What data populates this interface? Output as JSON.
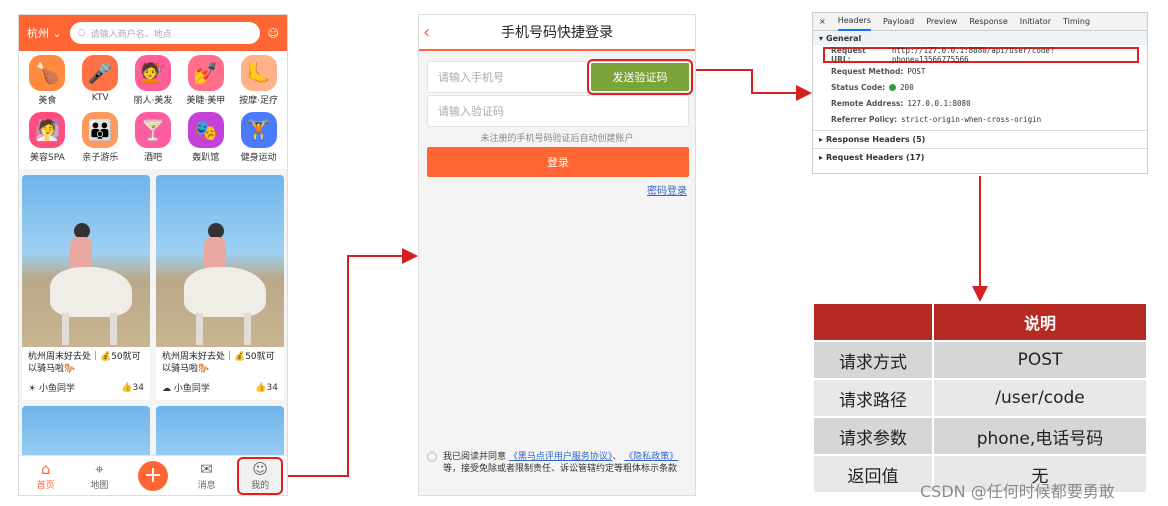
{
  "phone1": {
    "city": "杭州",
    "search_placeholder": "请输入商户名、地点",
    "categories": [
      {
        "label": "美食",
        "icon": "chicken-icon",
        "color": "#ff8a3d",
        "glyph": "🍗"
      },
      {
        "label": "KTV",
        "icon": "microphone-icon",
        "color": "#ff7043",
        "glyph": "🎤"
      },
      {
        "label": "丽人·美发",
        "icon": "hair-icon",
        "color": "#ff5e9a",
        "glyph": "💇"
      },
      {
        "label": "美睫·美甲",
        "icon": "nail-icon",
        "color": "#ff6f8a",
        "glyph": "💅"
      },
      {
        "label": "按摩·足疗",
        "icon": "foot-icon",
        "color": "#ffb28a",
        "glyph": "🦶"
      },
      {
        "label": "美容SPA",
        "icon": "mask-icon",
        "color": "#ff4d7d",
        "glyph": "🧖"
      },
      {
        "label": "亲子游乐",
        "icon": "family-icon",
        "color": "#ff9a5c",
        "glyph": "👪"
      },
      {
        "label": "酒吧",
        "icon": "cocktail-icon",
        "color": "#ff5da2",
        "glyph": "🍸"
      },
      {
        "label": "轰趴馆",
        "icon": "party-mask-icon",
        "color": "#c542d8",
        "glyph": "🎭"
      },
      {
        "label": "健身运动",
        "icon": "dumbbell-icon",
        "color": "#4a7bff",
        "glyph": "🏋"
      }
    ],
    "cards": [
      {
        "title": "杭州周末好去处｜💰50就可以骑马啦🐎",
        "author": "小鱼同学",
        "likes": "34"
      },
      {
        "title": "杭州周末好去处｜💰50就可以骑马啦🐎",
        "author": "小鱼同学",
        "likes": "34"
      }
    ],
    "tabs": [
      {
        "label": "首页",
        "glyph": "⌂"
      },
      {
        "label": "地图",
        "glyph": "⌖"
      },
      {
        "label": "+",
        "glyph": "+"
      },
      {
        "label": "消息",
        "glyph": "✉"
      },
      {
        "label": "我的",
        "glyph": "☺"
      }
    ]
  },
  "phone2": {
    "back": "‹",
    "title": "手机号码快捷登录",
    "phone_placeholder": "请输入手机号",
    "send_code": "发送验证码",
    "code_placeholder": "请输入验证码",
    "hint": "未注册的手机号码验证后自动创建账户",
    "login": "登录",
    "password_login": "密码登录",
    "agree_prefix": "我已阅读并同意",
    "agree_link1": "《黑马点评用户服务协议》",
    "agree_sep": "、",
    "agree_link2": "《隐私政策》",
    "agree_suffix": "等，接受免除或者限制责任、诉讼管辖约定等粗体标示条款"
  },
  "devtools": {
    "close": "×",
    "tabs": [
      "Headers",
      "Payload",
      "Preview",
      "Response",
      "Initiator",
      "Timing"
    ],
    "general": "General",
    "rows": [
      {
        "key": "Request URL:",
        "value": "http://127.0.0.1:8080/api/user/code?phone=13566775566"
      },
      {
        "key": "Request Method:",
        "value": "POST"
      },
      {
        "key": "Status Code:",
        "value": "200"
      },
      {
        "key": "Remote Address:",
        "value": "127.0.0.1:8080"
      },
      {
        "key": "Referrer Policy:",
        "value": "strict-origin-when-cross-origin"
      }
    ],
    "response_headers": "Response Headers (5)",
    "request_headers": "Request Headers (17)"
  },
  "table": {
    "header_key": "",
    "header_value": "说明",
    "rows": [
      {
        "k": "请求方式",
        "v": "POST"
      },
      {
        "k": "请求路径",
        "v": "/user/code"
      },
      {
        "k": "请求参数",
        "v": "phone,电话号码"
      },
      {
        "k": "返回值",
        "v": "无"
      }
    ]
  },
  "watermark": "CSDN @任何时候都要勇敢"
}
